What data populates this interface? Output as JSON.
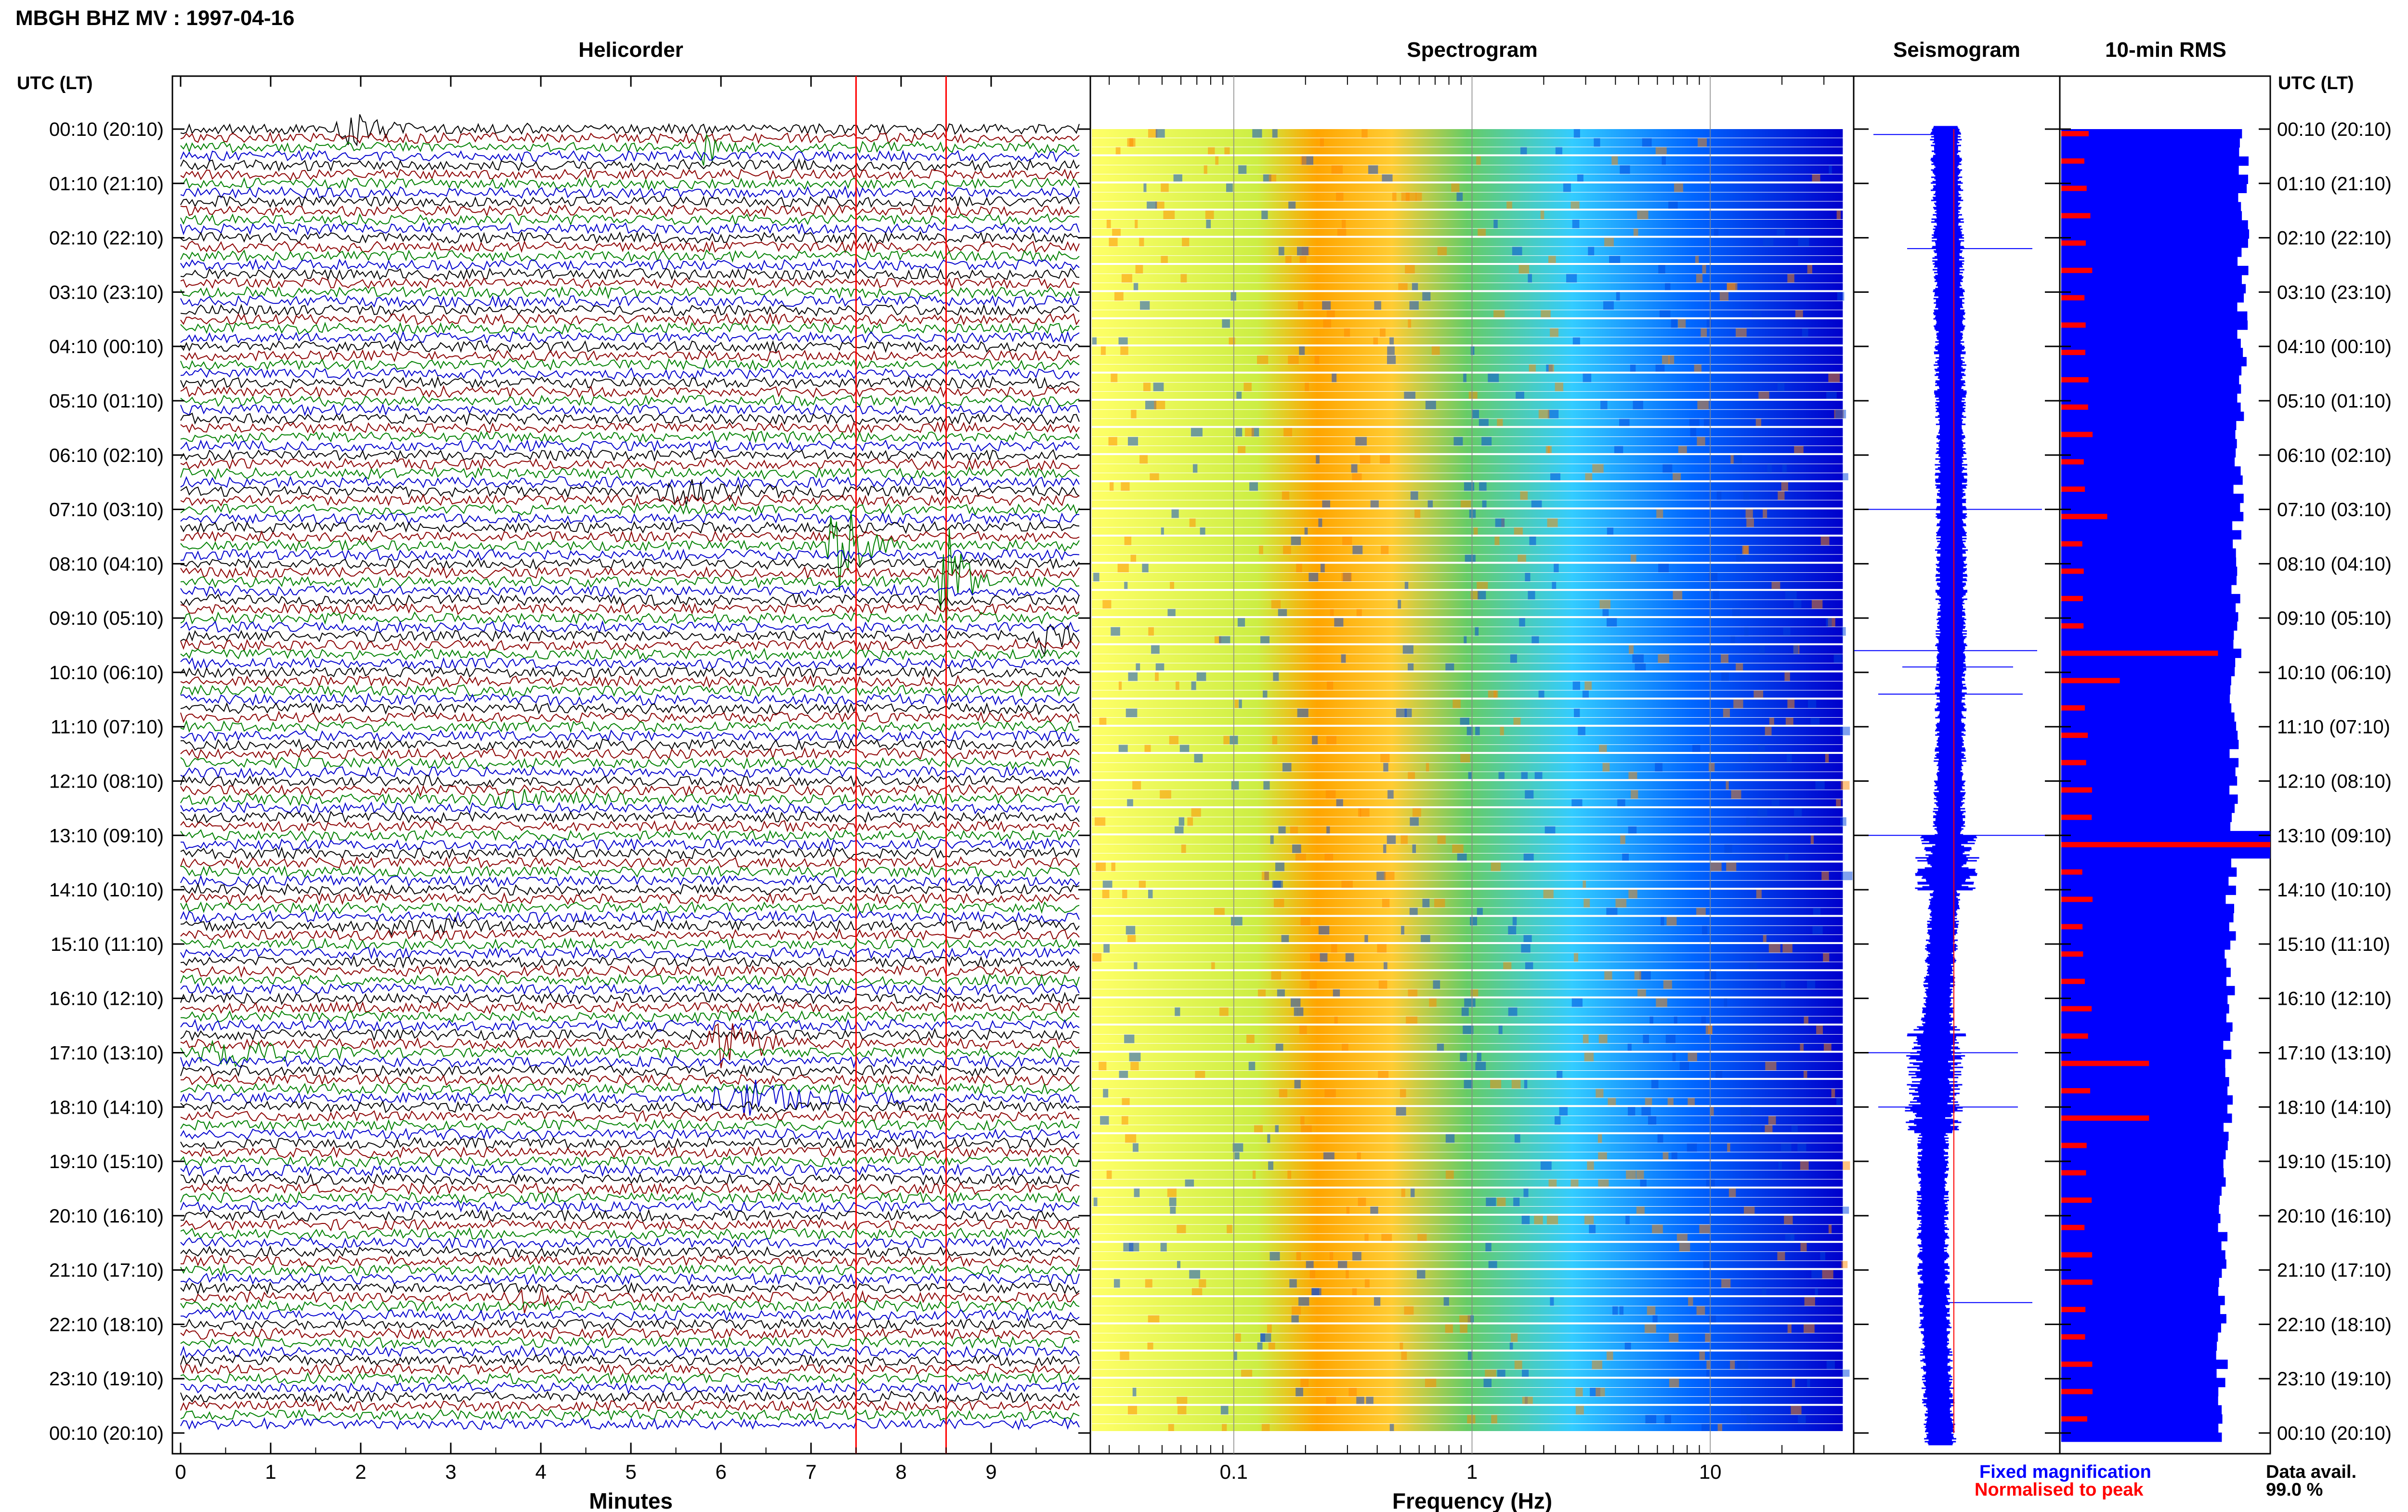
{
  "chart_data": {
    "type": "heatmap",
    "title": "MBGH BHZ MV : 1997-04-16",
    "left_axis_label": "UTC (LT)",
    "right_axis_label": "UTC (LT)",
    "panels": {
      "helicorder": {
        "title": "Helicorder",
        "xlabel": "Minutes",
        "xlim": [
          0,
          10
        ],
        "xticks": [
          0,
          1,
          2,
          3,
          4,
          5,
          6,
          7,
          8,
          9
        ],
        "trace_colors": [
          "#000000",
          "#8b0000",
          "#008000",
          "#0000cd"
        ],
        "red_markers_minutes": [
          7.5,
          8.5
        ],
        "events": [
          {
            "hour": 0.05,
            "minute": 1.9,
            "amplitude": 1.5,
            "width": 0.7
          },
          {
            "hour": 0.4,
            "minute": 5.8,
            "amplitude": 2.5,
            "width": 0.3
          },
          {
            "hour": 6.6,
            "minute": 5.6,
            "amplitude": 1.3,
            "width": 1.5
          },
          {
            "hour": 7.6,
            "minute": 7.3,
            "amplitude": 7.0,
            "width": 0.5
          },
          {
            "hour": 8.3,
            "minute": 8.5,
            "amplitude": 8.0,
            "width": 0.4
          },
          {
            "hour": 9.4,
            "minute": 9.6,
            "amplitude": 3.0,
            "width": 0.4
          },
          {
            "hour": 12.4,
            "minute": 3.5,
            "amplitude": 1.5,
            "width": 1.2
          },
          {
            "hour": 14.6,
            "minute": 2.5,
            "amplitude": 1.2,
            "width": 1.0
          },
          {
            "hour": 16.9,
            "minute": 6.0,
            "amplitude": 2.5,
            "width": 1.0
          },
          {
            "hour": 17.0,
            "minute": 0.5,
            "amplitude": 1.2,
            "width": 1.5
          },
          {
            "hour": 17.9,
            "minute": 6.2,
            "amplitude": 2.0,
            "width": 1.5
          },
          {
            "hour": 21.5,
            "minute": 3.8,
            "amplitude": 1.2,
            "width": 0.7
          }
        ]
      },
      "spectrogram": {
        "title": "Spectrogram",
        "xlabel": "Frequency (Hz)",
        "x_scale": "log",
        "xlim": [
          0.025,
          40
        ],
        "xtick_labels": [
          "0.1",
          "1",
          "10"
        ],
        "xtick_values": [
          0.1,
          1,
          10
        ],
        "colormap": [
          "#ffff66",
          "#ffa500",
          "#66cc66",
          "#33ccff",
          "#0066ff",
          "#0000cc"
        ]
      },
      "seismogram": {
        "title": "Seismogram"
      },
      "rms": {
        "title": "10-min RMS",
        "legend": [
          {
            "label": "Fixed magnification",
            "color": "#0000ff"
          },
          {
            "label": "Normalised to peak",
            "color": "#ff0000"
          }
        ],
        "data_availability_label": "Data avail.",
        "data_availability_value": "99.0 %"
      }
    },
    "time_labels": [
      "00:10 (20:10)",
      "01:10 (21:10)",
      "02:10 (22:10)",
      "03:10 (23:10)",
      "04:10 (00:10)",
      "05:10 (01:10)",
      "06:10 (02:10)",
      "07:10 (03:10)",
      "08:10 (04:10)",
      "09:10 (05:10)",
      "10:10 (06:10)",
      "11:10 (07:10)",
      "12:10 (08:10)",
      "13:10 (09:10)",
      "14:10 (10:10)",
      "15:10 (11:10)",
      "16:10 (12:10)",
      "17:10 (13:10)",
      "18:10 (14:10)",
      "19:10 (15:10)",
      "20:10 (16:10)",
      "21:10 (17:10)",
      "22:10 (18:10)",
      "23:10 (19:10)",
      "00:10 (20:10)"
    ]
  }
}
